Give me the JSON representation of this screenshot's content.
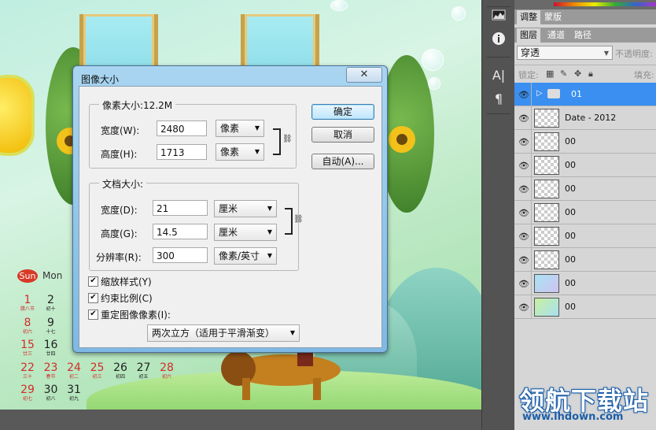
{
  "dialog": {
    "title": "图像大小",
    "close_glyph": "✕",
    "pixel_section": {
      "title": "像素大小:12.2M",
      "width_label": "宽度(W):",
      "width_value": "2480",
      "width_unit": "像素",
      "height_label": "高度(H):",
      "height_value": "1713",
      "height_unit": "像素"
    },
    "doc_section": {
      "title": "文档大小:",
      "width_label": "宽度(D):",
      "width_value": "21",
      "width_unit": "厘米",
      "height_label": "高度(G):",
      "height_value": "14.5",
      "height_unit": "厘米",
      "res_label": "分辨率(R):",
      "res_value": "300",
      "res_unit": "像素/英寸"
    },
    "checkboxes": {
      "scale_styles": {
        "label": "缩放样式(Y)",
        "checked": true
      },
      "constrain": {
        "label": "约束比例(C)",
        "checked": true
      },
      "resample": {
        "label": "重定图像像素(I):",
        "checked": true
      }
    },
    "resample_method": "两次立方（适用于平滑渐变）",
    "buttons": {
      "ok": "确定",
      "cancel": "取消",
      "auto": "自动(A)..."
    }
  },
  "calendar": {
    "sun_label": "Sun",
    "mon_label": "Mon",
    "days": [
      {
        "n": "1",
        "lunar": "腊八节",
        "color": "red"
      },
      {
        "n": "2",
        "lunar": "初十",
        "color": "blk"
      },
      {
        "n": "8",
        "lunar": "初六",
        "color": "red"
      },
      {
        "n": "9",
        "lunar": "十七",
        "color": "blk"
      },
      {
        "n": "15",
        "lunar": "廿三",
        "color": "red"
      },
      {
        "n": "16",
        "lunar": "廿四",
        "color": "blk"
      },
      {
        "n": "22",
        "lunar": "三十",
        "color": "red"
      },
      {
        "n": "23",
        "lunar": "春节",
        "color": "red"
      },
      {
        "n": "24",
        "lunar": "初二",
        "color": "red"
      },
      {
        "n": "25",
        "lunar": "初三",
        "color": "red"
      },
      {
        "n": "26",
        "lunar": "初四",
        "color": "blk"
      },
      {
        "n": "27",
        "lunar": "初五",
        "color": "blk"
      },
      {
        "n": "28",
        "lunar": "初六",
        "color": "red"
      },
      {
        "n": "29",
        "lunar": "初七",
        "color": "red"
      },
      {
        "n": "30",
        "lunar": "初八",
        "color": "blk"
      },
      {
        "n": "31",
        "lunar": "初九",
        "color": "blk"
      }
    ]
  },
  "panel": {
    "tabs_top": [
      "调整",
      "蒙版"
    ],
    "tabs_layers": [
      "图层",
      "通道",
      "路径"
    ],
    "blend_mode": "穿透",
    "opacity_label": "不透明度:",
    "lock_label": "锁定:",
    "fill_label": "填充:",
    "layers": [
      {
        "name": "01",
        "type": "group",
        "selected": true
      },
      {
        "name": "Date - 2012",
        "type": "layer",
        "selected": false
      },
      {
        "name": "00",
        "type": "layer",
        "selected": false
      },
      {
        "name": "00",
        "type": "layer",
        "selected": false
      },
      {
        "name": "00",
        "type": "layer",
        "selected": false
      },
      {
        "name": "00",
        "type": "layer",
        "selected": false
      },
      {
        "name": "00",
        "type": "layer",
        "selected": false
      },
      {
        "name": "00",
        "type": "layer",
        "selected": false
      },
      {
        "name": "00",
        "type": "layer",
        "selected": false
      },
      {
        "name": "00",
        "type": "layer",
        "selected": false
      }
    ]
  },
  "toolstrip": {
    "icons": [
      "histogram-icon",
      "info-icon",
      "character-icon",
      "paragraph-icon"
    ]
  },
  "watermark": {
    "text": "领航下载站",
    "url": "www.lhdown.com"
  },
  "colors": {
    "accent": "#3a8ff0",
    "dialog_frame": "#7fb9e2",
    "ok_button": "#bee6fd"
  }
}
